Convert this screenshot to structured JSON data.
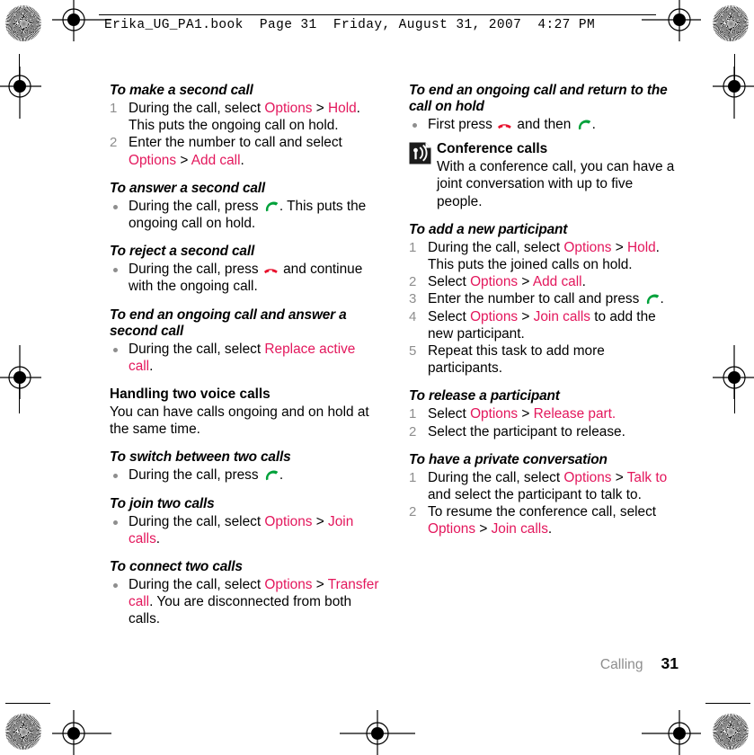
{
  "header": {
    "text": "Erika_UG_PA1.book  Page 31  Friday, August 31, 2007  4:27 PM"
  },
  "footer": {
    "chapter": "Calling",
    "page_number": "31"
  },
  "colors": {
    "ui_term": "#e3175c",
    "answer_key": "#00a13a",
    "end_key": "#e8112d",
    "marker_gray": "#8e8e8e"
  },
  "left_column": {
    "s1": {
      "heading": "To make a second call",
      "step1_a": "During the call, select ",
      "step1_options": "Options",
      "step1_gt": " > ",
      "step1_hold": "Hold",
      "step1_b": ". This puts the ongoing call on hold.",
      "step2_a": "Enter the number to call and select ",
      "step2_options": "Options",
      "step2_gt": " > ",
      "step2_add": "Add call",
      "step2_b": "."
    },
    "s2": {
      "heading": "To answer a second call",
      "b1_a": "During the call, press ",
      "b1_b": ". This puts the ongoing call on hold."
    },
    "s3": {
      "heading": "To reject a second call",
      "b1_a": "During the call, press ",
      "b1_b": " and continue with the ongoing call."
    },
    "s4": {
      "heading": "To end an ongoing call and answer a second call",
      "b1_a": "During the call, select ",
      "b1_term": "Replace active call",
      "b1_b": "."
    },
    "s5": {
      "heading": "Handling two voice calls",
      "body": "You can have calls ongoing and on hold at the same time."
    },
    "s6": {
      "heading": "To switch between two calls",
      "b1_a": "During the call, press ",
      "b1_b": "."
    },
    "s7": {
      "heading": "To join two calls",
      "b1_a": "During the call, select ",
      "b1_options": "Options",
      "b1_gt": " > ",
      "b1_join": "Join calls",
      "b1_b": "."
    },
    "s8": {
      "heading": "To connect two calls",
      "b1_a": "During the call, select ",
      "b1_options": "Options",
      "b1_gt": " > ",
      "b1_transfer": "Transfer call",
      "b1_b": ". You are disconnected from both calls."
    }
  },
  "right_column": {
    "s1": {
      "heading": "To end an ongoing call and return to the call on hold",
      "b1_a": "First press ",
      "b1_mid": " and then ",
      "b1_b": "."
    },
    "note": {
      "icon": "conference-call-icon",
      "heading": "Conference calls",
      "body": "With a conference call, you can have a joint conversation with up to five people."
    },
    "s2": {
      "heading": "To add a new participant",
      "step1_a": "During the call, select ",
      "step1_options": "Options",
      "step1_gt": " > ",
      "step1_hold": "Hold",
      "step1_b": ". This puts the joined calls on hold.",
      "step2_a": "Select ",
      "step2_options": "Options",
      "step2_gt": " > ",
      "step2_add": "Add call",
      "step2_b": ".",
      "step3_a": "Enter the number to call and press ",
      "step3_b": ".",
      "step4_a": "Select ",
      "step4_options": "Options",
      "step4_gt": " > ",
      "step4_join": "Join calls",
      "step4_b": " to add the new participant.",
      "step5": "Repeat this task to add more participants."
    },
    "s3": {
      "heading": "To release a participant",
      "step1_a": "Select ",
      "step1_options": "Options",
      "step1_gt": " > ",
      "step1_release": "Release part.",
      "step2": "Select the participant to release."
    },
    "s4": {
      "heading": "To have a private conversation",
      "step1_a": "During the call, select ",
      "step1_options": "Options",
      "step1_gt": " > ",
      "step1_talk": "Talk to",
      "step1_b": " and select the participant to talk to.",
      "step2_a": "To resume the conference call, select ",
      "step2_options": "Options",
      "step2_gt": " > ",
      "step2_join": "Join calls",
      "step2_b": "."
    }
  }
}
